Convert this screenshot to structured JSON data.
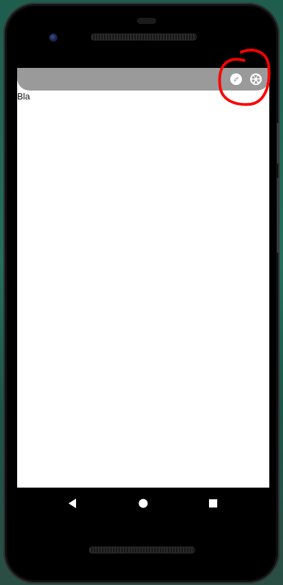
{
  "screen": {
    "body_text": "Bla"
  },
  "app_bar": {
    "background": "#9a9a9a",
    "actions": [
      {
        "icon": "compass-icon"
      },
      {
        "icon": "aperture-icon"
      }
    ]
  },
  "navigation_bar": {
    "buttons": [
      {
        "icon": "back-triangle-icon"
      },
      {
        "icon": "home-circle-icon"
      },
      {
        "icon": "recents-square-icon"
      }
    ]
  },
  "annotation": {
    "color": "#ff0000"
  }
}
